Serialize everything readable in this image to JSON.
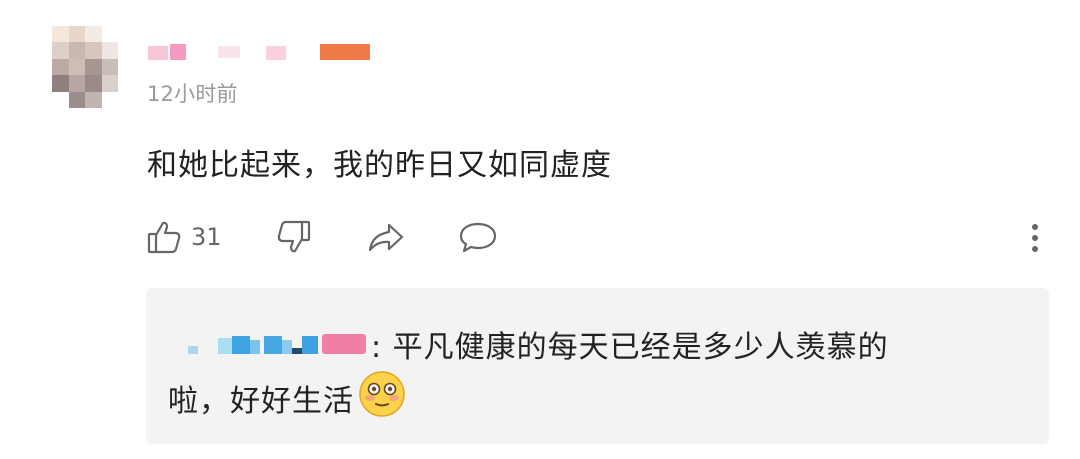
{
  "comment": {
    "timestamp": "12小时前",
    "text": "和她比起来，我的昨日又如同虚度",
    "like_count": "31"
  },
  "icons": {
    "like": "thumbs-up-icon",
    "dislike": "thumbs-down-icon",
    "share": "share-arrow-icon",
    "reply": "comment-bubble-icon",
    "more": "more-vertical-icon",
    "emoji": "blushing-face-emoji"
  },
  "reply": {
    "separator": ": ",
    "text_line1": "平凡健康的每天已经是多少人羡慕的",
    "text_line2": "啦，好好生活"
  },
  "colors": {
    "reply_bg": "#f3f3f3",
    "meta_text": "#9a9a9a",
    "body_text": "#222222",
    "icon": "#666666",
    "badge": "#f07fa6"
  }
}
